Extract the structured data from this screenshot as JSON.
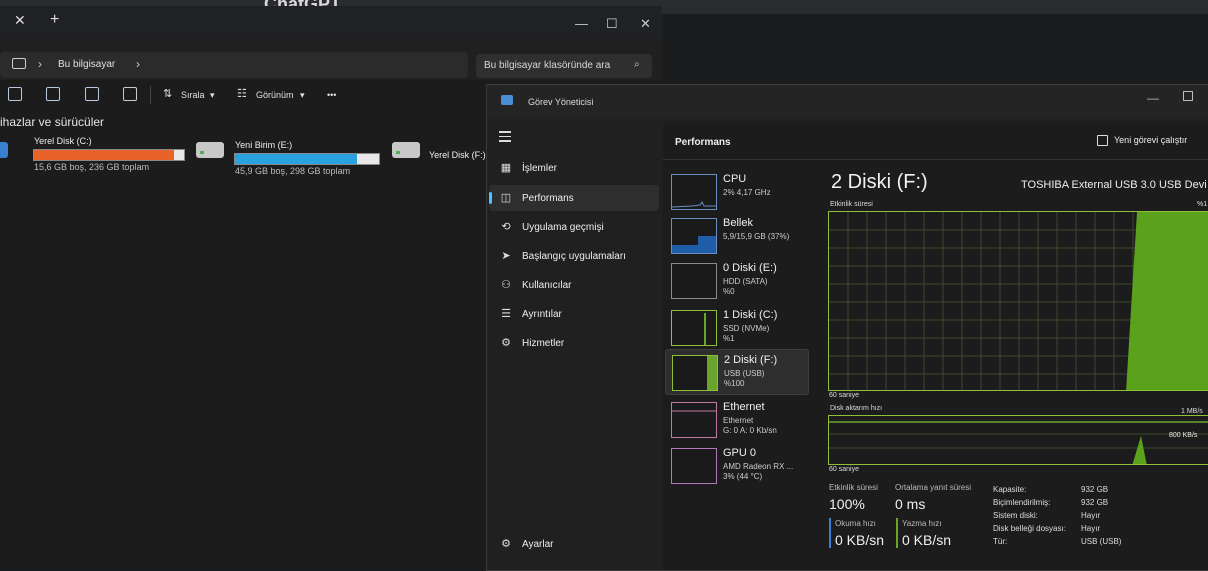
{
  "background": {
    "title": "ChatGPT"
  },
  "explorer": {
    "tab_close": "✕",
    "tab_add": "+",
    "window_controls": {
      "minimize": "—",
      "maximize": "☐",
      "close": "✕"
    },
    "breadcrumb": "Bu bilgisayar",
    "search_placeholder": "Bu bilgisayar klasöründe ara",
    "toolbar": {
      "sort_label": "Sırala",
      "view_label": "Görünüm",
      "more_label": "•••"
    },
    "section_title": "ihazlar ve sürücüler",
    "drives": [
      {
        "name": "Yerel Disk (C:)",
        "info": "15,6 GB boş, 236 GB toplam",
        "used_fraction": 0.93,
        "bar_color": "#e8632a"
      },
      {
        "name": "Yeni Birim (E:)",
        "info": "45,9 GB boş, 298 GB toplam",
        "used_fraction": 0.85,
        "bar_color": "#2aa2e0"
      },
      {
        "name": "Yerel Disk (F:)",
        "info": ""
      }
    ]
  },
  "taskmanager": {
    "app_name": "Görev Yöneticisi",
    "window_controls": {
      "minimize": "—"
    },
    "nav": [
      {
        "icon": "▦",
        "label": "İşlemler"
      },
      {
        "icon": "◫",
        "label": "Performans"
      },
      {
        "icon": "⟲",
        "label": "Uygulama geçmişi"
      },
      {
        "icon": "➤",
        "label": "Başlangıç uygulamaları"
      },
      {
        "icon": "⚇",
        "label": "Kullanıcılar"
      },
      {
        "icon": "☰",
        "label": "Ayrıntılar"
      },
      {
        "icon": "⚙",
        "label": "Hizmetler"
      }
    ],
    "settings": {
      "icon": "⚙",
      "label": "Ayarlar"
    },
    "page_title": "Performans",
    "new_task": "Yeni görevi çalıştır",
    "resources": [
      {
        "name": "CPU",
        "sub1": "2% 4,17 GHz",
        "sub2": ""
      },
      {
        "name": "Bellek",
        "sub1": "5,9/15,9 GB (37%)",
        "sub2": ""
      },
      {
        "name": "0 Diski (E:)",
        "sub1": "HDD (SATA)",
        "sub2": "%0"
      },
      {
        "name": "1 Diski (C:)",
        "sub1": "SSD (NVMe)",
        "sub2": "%1"
      },
      {
        "name": "2 Diski (F:)",
        "sub1": "USB (USB)",
        "sub2": "%100"
      },
      {
        "name": "Ethernet",
        "sub1": "Ethernet",
        "sub2": "G: 0 A: 0 Kb/sn"
      },
      {
        "name": "GPU 0",
        "sub1": "AMD Radeon RX ...",
        "sub2": "3% (44 °C)"
      }
    ],
    "detail": {
      "title": "2 Diski (F:)",
      "model": "TOSHIBA External USB 3.0 USB Devi",
      "graph1_label": "Etkinlik süresi",
      "graph1_max": "%1",
      "graph1_time": "60 saniye",
      "graph2_label": "Disk aktarım hızı",
      "graph2_max": "1 MB/s",
      "graph2_mid": "800 KB/s",
      "graph2_time": "60 saniye",
      "active_time_label": "Etkinlik süresi",
      "active_time_value": "100%",
      "avg_response_label": "Ortalama yanıt süresi",
      "avg_response_value": "0 ms",
      "read_label": "Okuma hızı",
      "read_value": "0 KB/sn",
      "write_label": "Yazma hızı",
      "write_value": "0 KB/sn",
      "props": [
        {
          "k": "Kapasite:",
          "v": "932 GB"
        },
        {
          "k": "Biçimlendirilmiş:",
          "v": "932 GB"
        },
        {
          "k": "Sistem diski:",
          "v": "Hayır"
        },
        {
          "k": "Disk belleği dosyası:",
          "v": "Hayır"
        },
        {
          "k": "Tür:",
          "v": "USB (USB)"
        }
      ]
    }
  }
}
